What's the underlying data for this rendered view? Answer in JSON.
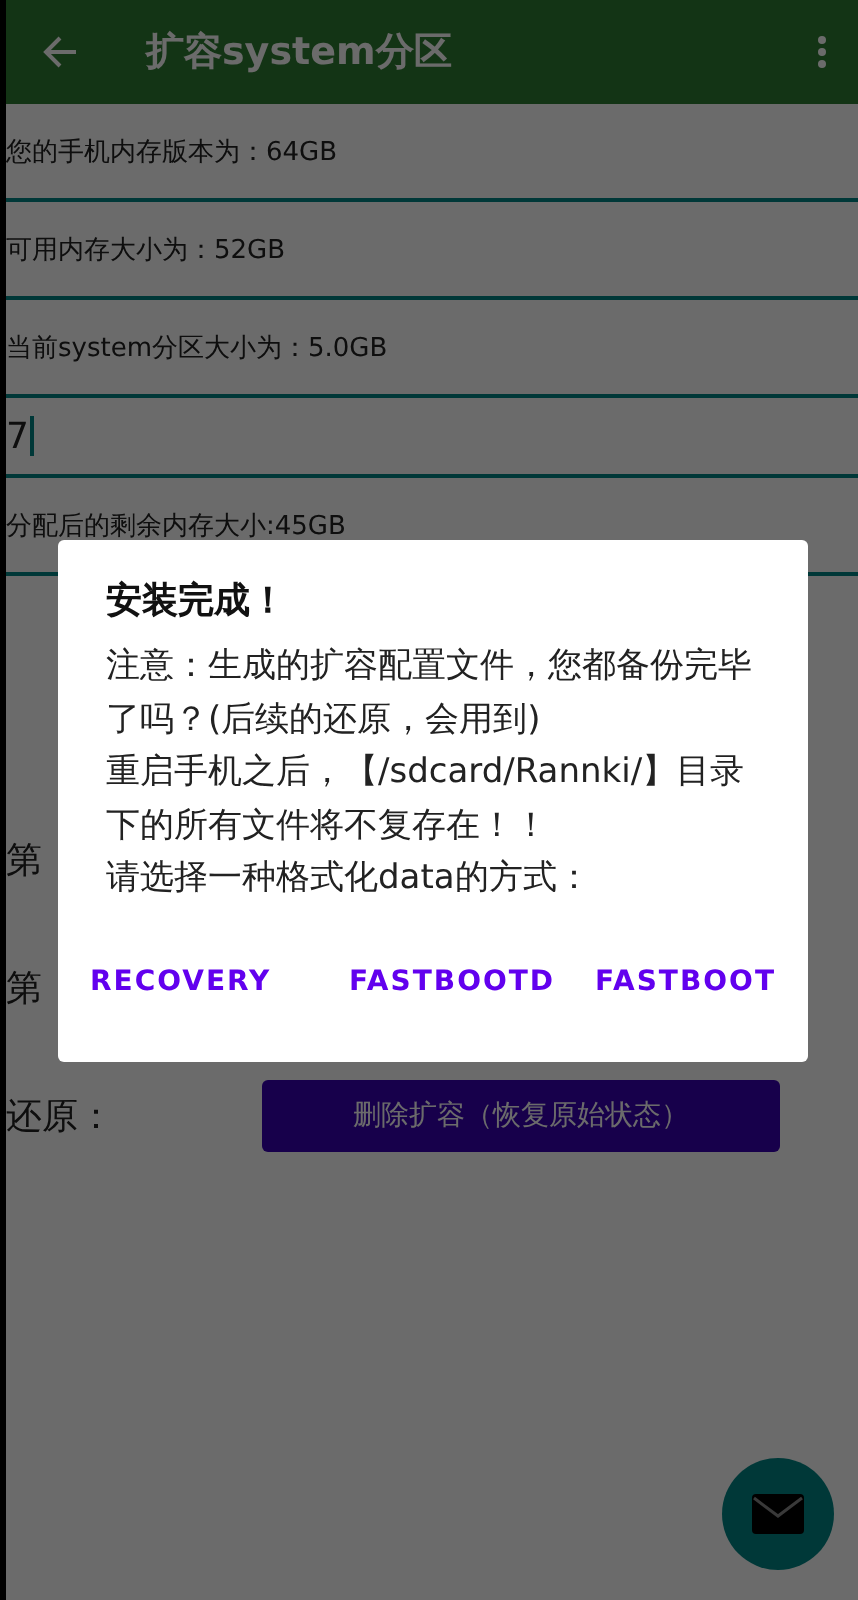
{
  "app_bar": {
    "title": "扩容system分区"
  },
  "rows": [
    {
      "kind": "text",
      "text": "您的手机内存版本为：64GB"
    },
    {
      "kind": "text",
      "text": "可用内存大小为：52GB"
    },
    {
      "kind": "text",
      "text": "当前system分区大小为：5.0GB"
    },
    {
      "kind": "input",
      "value": "7",
      "focused": true
    },
    {
      "kind": "text",
      "text": "分配后的剩余内存大小:45GB"
    }
  ],
  "steps": [
    {
      "label": "第"
    },
    {
      "label": "第"
    }
  ],
  "restore": {
    "label": "还原：",
    "button": "删除扩容（恢复原始状态）"
  },
  "dialog": {
    "title": "安装完成！",
    "message": [
      "注意：生成的扩容配置文件，您都备份完毕了吗？(后续的还原，会用到)",
      "重启手机之后，【/sdcard/Rannki/】目录下的所有文件将不复存在！！",
      "请选择一种格式化data的方式："
    ],
    "buttons": [
      "RECOVERY",
      "FASTBOOTD",
      "FASTBOOT"
    ]
  }
}
